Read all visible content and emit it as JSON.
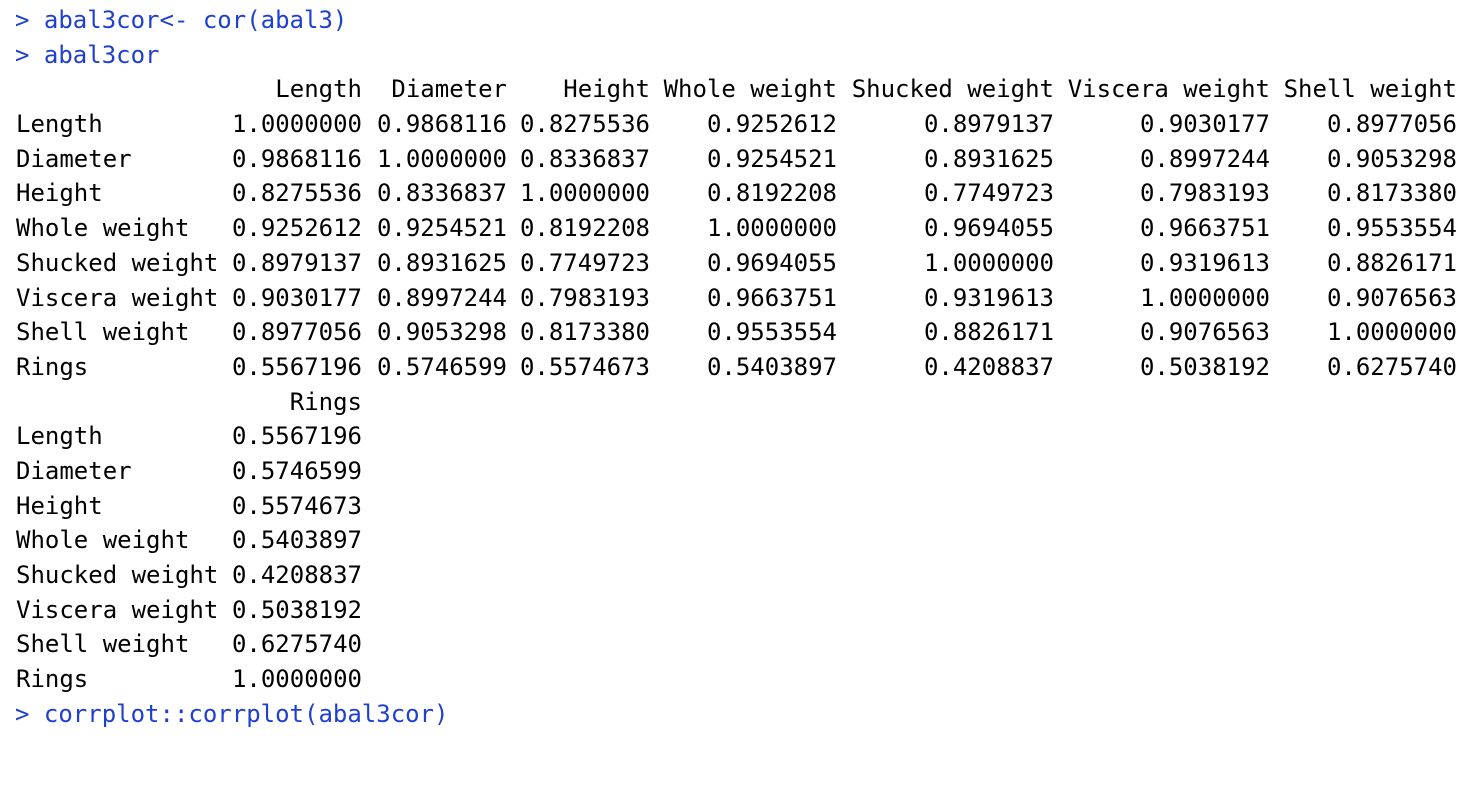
{
  "prompt_symbol": ">",
  "commands": [
    "abal3cor<- cor(abal3)",
    "abal3cor",
    "corrplot::corrplot(abal3cor)"
  ],
  "matrix_block1": {
    "headers": [
      "Length",
      "Diameter",
      "Height",
      "Whole weight",
      "Shucked weight",
      "Viscera weight",
      "Shell weight"
    ],
    "rows": [
      {
        "label": "Length",
        "values": [
          "1.0000000",
          "0.9868116",
          "0.8275536",
          "0.9252612",
          "0.8979137",
          "0.9030177",
          "0.8977056"
        ]
      },
      {
        "label": "Diameter",
        "values": [
          "0.9868116",
          "1.0000000",
          "0.8336837",
          "0.9254521",
          "0.8931625",
          "0.8997244",
          "0.9053298"
        ]
      },
      {
        "label": "Height",
        "values": [
          "0.8275536",
          "0.8336837",
          "1.0000000",
          "0.8192208",
          "0.7749723",
          "0.7983193",
          "0.8173380"
        ]
      },
      {
        "label": "Whole weight",
        "values": [
          "0.9252612",
          "0.9254521",
          "0.8192208",
          "1.0000000",
          "0.9694055",
          "0.9663751",
          "0.9553554"
        ]
      },
      {
        "label": "Shucked weight",
        "values": [
          "0.8979137",
          "0.8931625",
          "0.7749723",
          "0.9694055",
          "1.0000000",
          "0.9319613",
          "0.8826171"
        ]
      },
      {
        "label": "Viscera weight",
        "values": [
          "0.9030177",
          "0.8997244",
          "0.7983193",
          "0.9663751",
          "0.9319613",
          "1.0000000",
          "0.9076563"
        ]
      },
      {
        "label": "Shell weight",
        "values": [
          "0.8977056",
          "0.9053298",
          "0.8173380",
          "0.9553554",
          "0.8826171",
          "0.9076563",
          "1.0000000"
        ]
      },
      {
        "label": "Rings",
        "values": [
          "0.5567196",
          "0.5746599",
          "0.5574673",
          "0.5403897",
          "0.4208837",
          "0.5038192",
          "0.6275740"
        ]
      }
    ]
  },
  "matrix_block2": {
    "headers": [
      "Rings"
    ],
    "rows": [
      {
        "label": "Length",
        "values": [
          "0.5567196"
        ]
      },
      {
        "label": "Diameter",
        "values": [
          "0.5746599"
        ]
      },
      {
        "label": "Height",
        "values": [
          "0.5574673"
        ]
      },
      {
        "label": "Whole weight",
        "values": [
          "0.5403897"
        ]
      },
      {
        "label": "Shucked weight",
        "values": [
          "0.4208837"
        ]
      },
      {
        "label": "Viscera weight",
        "values": [
          "0.5038192"
        ]
      },
      {
        "label": "Shell weight",
        "values": [
          "0.6275740"
        ]
      },
      {
        "label": "Rings",
        "values": [
          "1.0000000"
        ]
      }
    ]
  },
  "colors": {
    "command_text": "#1f3fd0",
    "output_text": "#000000",
    "background": "#ffffff"
  }
}
